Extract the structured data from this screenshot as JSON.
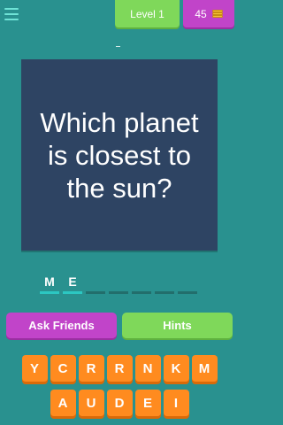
{
  "header": {
    "level_label": "Level 1",
    "coins": "45",
    "coin_icon": "coin-stack-icon",
    "menu_icon": "hamburger-menu-icon"
  },
  "question": {
    "marker": "-",
    "text": "Which planet is closest to the sun?"
  },
  "answer": {
    "slots": [
      "M",
      "E",
      "",
      "",
      "",
      "",
      ""
    ]
  },
  "actions": {
    "ask_friends": "Ask Friends",
    "hints": "Hints"
  },
  "keyboard": {
    "row1": [
      "Y",
      "C",
      "R",
      "R",
      "N",
      "K",
      "M"
    ],
    "row2": [
      "A",
      "U",
      "D",
      "E",
      "I"
    ]
  },
  "colors": {
    "background": "#29918f",
    "card": "#2e4463",
    "purple": "#c144c9",
    "green": "#7fd85a",
    "orange": "#ff8b1f"
  }
}
